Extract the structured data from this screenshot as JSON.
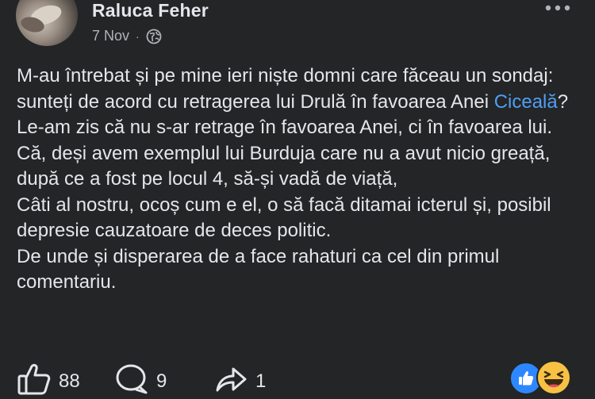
{
  "post": {
    "author": "Raluca Feher",
    "date": "7 Nov",
    "separator": "·",
    "privacy_icon": "globe-icon",
    "menu_icon": "more-dots-icon",
    "lines": [
      "M-au întrebat și pe mine ieri niște domni care făceau un sondaj: sunteți de acord cu retragerea lui Drulă în favoarea Anei ",
      "Le-am zis că nu s-ar retrage în favoarea Anei, ci în favoarea lui.",
      "Că, deși avem exemplul lui Burduja care nu a avut nicio greață, după ce a fost pe locul 4, să-și vadă de viață,",
      "Câti al nostru, ocoș cum e el, o să facă ditamai icterul și, posibil depresie cauzatoare de deces politic.",
      "De unde și disperarea de a face rahaturi ca cel din primul comentariu."
    ],
    "mention": "Ciceală",
    "mention_suffix": "?"
  },
  "actions": {
    "like_count": "88",
    "comment_count": "9",
    "share_count": "1"
  },
  "reactions": [
    "like",
    "haha"
  ],
  "colors": {
    "background": "#242526",
    "text": "#e4e6eb",
    "secondary": "#b0b3b8",
    "link": "#4f9ef7",
    "like_blue": "#2d88ff",
    "haha_yellow": "#f7c244"
  }
}
